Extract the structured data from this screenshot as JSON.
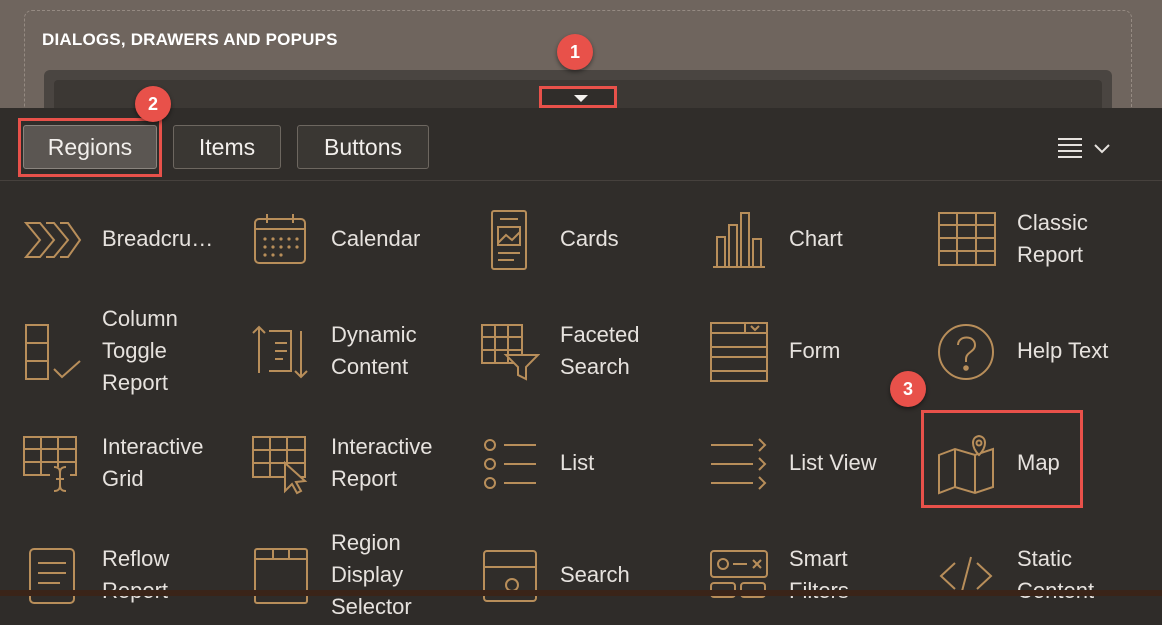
{
  "region": {
    "title": "DIALOGS, DRAWERS AND POPUPS"
  },
  "badges": [
    "1",
    "2",
    "3"
  ],
  "tabs": [
    {
      "label": "Regions",
      "active": true
    },
    {
      "label": "Items",
      "active": false
    },
    {
      "label": "Buttons",
      "active": false
    }
  ],
  "view_menu": {
    "icon": "hamburger-icon",
    "chevron": "chevron-down-icon"
  },
  "colors": {
    "accent": "#e8514a",
    "icon": "#b88e5a",
    "text": "#e6e2de"
  },
  "gallery": [
    {
      "label": "Breadcru…",
      "icon": "breadcrumb-icon"
    },
    {
      "label": "Calendar",
      "icon": "calendar-icon"
    },
    {
      "label": "Cards",
      "icon": "cards-icon"
    },
    {
      "label": "Chart",
      "icon": "chart-icon"
    },
    {
      "label": "Classic\nReport",
      "icon": "classic-report-icon"
    },
    {
      "label": "Column\nToggle\nReport",
      "icon": "column-toggle-report-icon"
    },
    {
      "label": "Dynamic\nContent",
      "icon": "dynamic-content-icon"
    },
    {
      "label": "Faceted\nSearch",
      "icon": "faceted-search-icon"
    },
    {
      "label": "Form",
      "icon": "form-icon"
    },
    {
      "label": "Help Text",
      "icon": "help-text-icon"
    },
    {
      "label": "Interactive\nGrid",
      "icon": "interactive-grid-icon"
    },
    {
      "label": "Interactive\nReport",
      "icon": "interactive-report-icon"
    },
    {
      "label": "List",
      "icon": "list-icon"
    },
    {
      "label": "List View",
      "icon": "list-view-icon"
    },
    {
      "label": "Map",
      "icon": "map-icon"
    },
    {
      "label": "Reflow\nReport",
      "icon": "reflow-report-icon"
    },
    {
      "label": "Region\nDisplay\nSelector",
      "icon": "region-display-selector-icon"
    },
    {
      "label": "Search",
      "icon": "search-region-icon"
    },
    {
      "label": "Smart\nFilters",
      "icon": "smart-filters-icon"
    },
    {
      "label": "Static\nContent",
      "icon": "static-content-icon"
    }
  ]
}
